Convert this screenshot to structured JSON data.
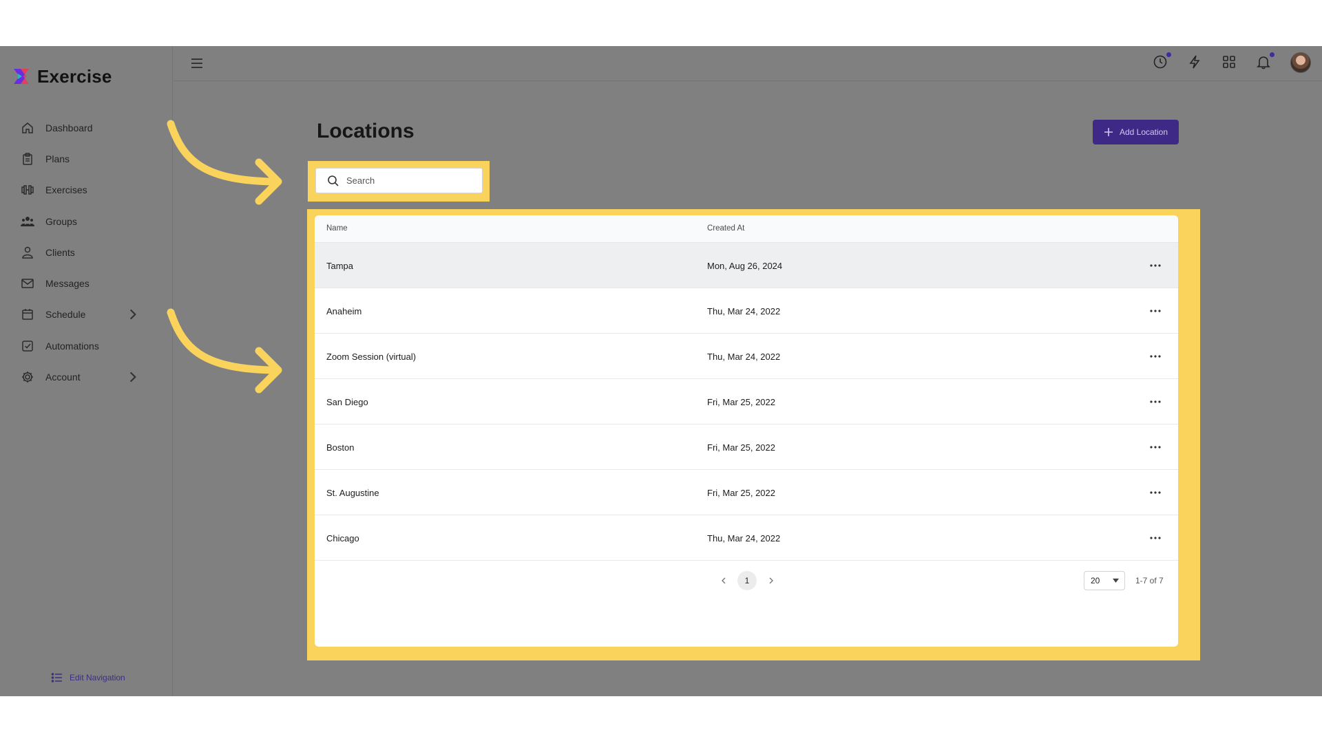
{
  "brand": {
    "name": "Exercise",
    "logo_icon": "exercise-logo-icon"
  },
  "sidebar": {
    "items": [
      {
        "label": "Dashboard",
        "icon": "home-icon"
      },
      {
        "label": "Plans",
        "icon": "clipboard-icon"
      },
      {
        "label": "Exercises",
        "icon": "dumbbell-icon"
      },
      {
        "label": "Groups",
        "icon": "users-icon"
      },
      {
        "label": "Clients",
        "icon": "user-icon"
      },
      {
        "label": "Messages",
        "icon": "mail-icon"
      },
      {
        "label": "Schedule",
        "icon": "calendar-icon",
        "has_submenu": true
      },
      {
        "label": "Automations",
        "icon": "checkbox-icon"
      },
      {
        "label": "Account",
        "icon": "gear-icon",
        "has_submenu": true
      }
    ],
    "edit_navigation": "Edit Navigation"
  },
  "topbar": {
    "icons": [
      "clock-icon",
      "bolt-icon",
      "apps-grid-icon",
      "bell-icon"
    ],
    "accent": "#3b2f99"
  },
  "main": {
    "title": "Locations",
    "add_button": "Add Location",
    "search": {
      "placeholder": "Search",
      "value": ""
    },
    "table": {
      "columns": [
        "Name",
        "Created At"
      ],
      "rows": [
        {
          "name": "Tampa",
          "created": "Mon, Aug 26, 2024"
        },
        {
          "name": "Anaheim",
          "created": "Thu, Mar 24, 2022"
        },
        {
          "name": "Zoom Session (virtual)",
          "created": "Thu, Mar 24, 2022"
        },
        {
          "name": "San Diego",
          "created": "Fri, Mar 25, 2022"
        },
        {
          "name": "Boston",
          "created": "Fri, Mar 25, 2022"
        },
        {
          "name": "St. Augustine",
          "created": "Fri, Mar 25, 2022"
        },
        {
          "name": "Chicago",
          "created": "Thu, Mar 24, 2022"
        }
      ]
    },
    "pagination": {
      "current_page": "1",
      "per_page": "20",
      "count": "1-7 of 7"
    }
  },
  "colors": {
    "highlight": "#f9d35c",
    "primary": "#3e2a86",
    "overlay": "#808080"
  }
}
